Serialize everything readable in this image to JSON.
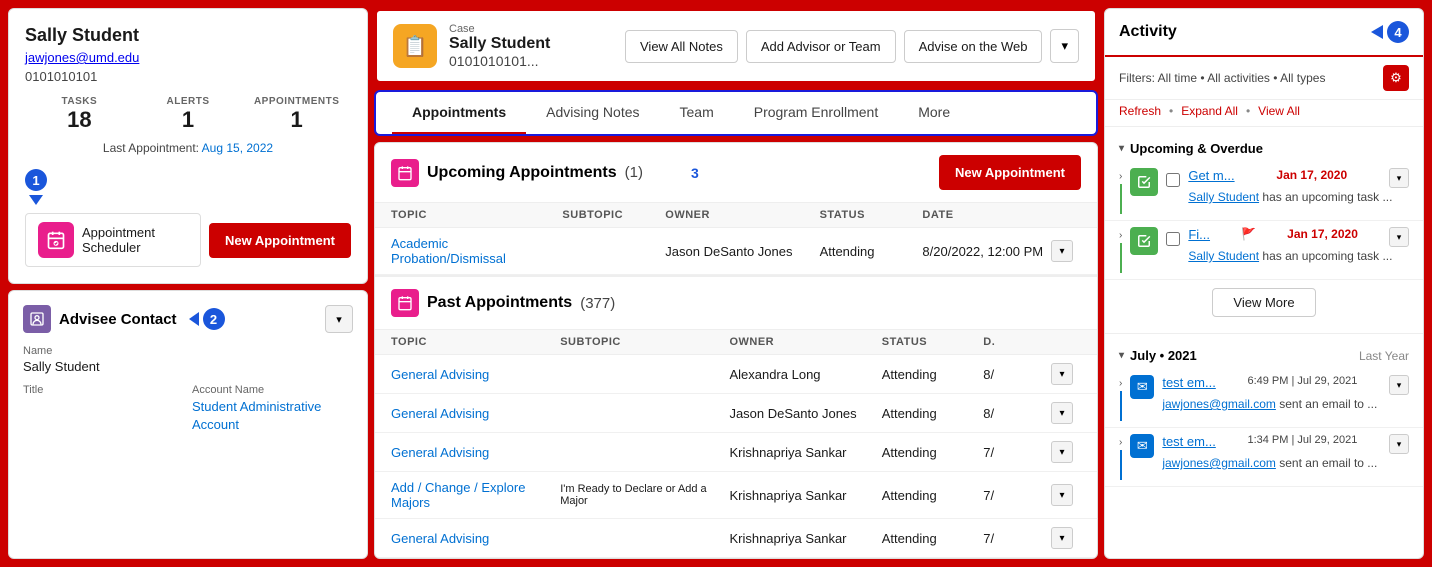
{
  "leftPanel": {
    "studentName": "Sally Student",
    "studentEmail": "jawjones@umd.edu",
    "studentId": "0101010101",
    "stats": {
      "tasksLabel": "TASKS",
      "tasksValue": "18",
      "alertsLabel": "ALERTS",
      "alertsValue": "1",
      "appointmentsLabel": "APPOINTMENTS",
      "appointmentsValue": "1"
    },
    "lastAppointment": "Last Appointment:",
    "lastAppointmentDate": "Aug 15, 2022",
    "appointmentSchedulerLabel": "Appointment\nScheduler",
    "newAppointmentBtn": "New Appointment",
    "annotation1": "1"
  },
  "adviseeContact": {
    "title": "Advisee Contact",
    "nameLabel": "Name",
    "nameValue": "Sally Student",
    "titleLabel": "Title",
    "accountNameLabel": "Account Name",
    "accountNameLink": "Student Administrative Account",
    "annotation2": "2"
  },
  "caseHeader": {
    "caseLabel": "Case",
    "caseName": "Sally Student",
    "caseId": "0101010101...",
    "viewAllNotesBtn": "View All Notes",
    "addAdvisorBtn": "Add Advisor or Team",
    "adviseOnWebBtn": "Advise on the Web"
  },
  "tabs": {
    "items": [
      {
        "label": "Appointments",
        "active": true
      },
      {
        "label": "Advising Notes",
        "active": false
      },
      {
        "label": "Team",
        "active": false
      },
      {
        "label": "Program Enrollment",
        "active": false
      },
      {
        "label": "More",
        "active": false
      }
    ]
  },
  "upcomingAppointments": {
    "title": "Upcoming Appointments",
    "count": "(1)",
    "newAppointmentBtn": "New Appointment",
    "annotation3": "3",
    "columns": [
      "TOPIC",
      "SUBTOPIC",
      "OWNER",
      "STATUS",
      "DATE"
    ],
    "rows": [
      {
        "topic": "Academic Probation/Dismissal",
        "subtopic": "",
        "owner": "Jason DeSanto Jones",
        "status": "Attending",
        "date": "8/20/2022, 12:00 PM"
      }
    ]
  },
  "pastAppointments": {
    "title": "Past Appointments",
    "count": "(377)",
    "columns": [
      "TOPIC",
      "SUBTOPIC",
      "OWNER",
      "STATUS",
      "D."
    ],
    "rows": [
      {
        "topic": "General Advising",
        "subtopic": "",
        "owner": "Alexandra Long",
        "status": "Attending",
        "date": "8/"
      },
      {
        "topic": "General Advising",
        "subtopic": "",
        "owner": "Jason DeSanto Jones",
        "status": "Attending",
        "date": "8/"
      },
      {
        "topic": "General Advising",
        "subtopic": "",
        "owner": "Krishnapriya Sankar",
        "status": "Attending",
        "date": "7/"
      },
      {
        "topic": "Add / Change / Explore Majors",
        "subtopic": "I'm Ready to Declare or Add a Major",
        "owner": "Krishnapriya Sankar",
        "status": "Attending",
        "date": "7/"
      },
      {
        "topic": "General Advising",
        "subtopic": "",
        "owner": "Krishnapriya Sankar",
        "status": "Attending",
        "date": "7/"
      }
    ]
  },
  "activity": {
    "title": "Activity",
    "annotation4": "4",
    "filtersText": "Filters: All time • All activities • All types",
    "refreshLink": "Refresh",
    "expandAllLink": "Expand All",
    "viewAllLink": "View All",
    "upcomingOverdue": {
      "sectionTitle": "Upcoming & Overdue",
      "items": [
        {
          "titleShort": "Get m...",
          "date": "Jan 17, 2020",
          "studentName": "Sally Student",
          "desc": "has an upcoming task ..."
        },
        {
          "titleShort": "Fi...",
          "date": "Jan 17, 2020",
          "studentName": "Sally Student",
          "desc": "has an upcoming task ...",
          "flagged": true
        }
      ],
      "viewMoreBtn": "View More"
    },
    "julySection": {
      "sectionTitle": "July • 2021",
      "sectionMeta": "Last Year",
      "items": [
        {
          "titleShort": "test em...",
          "time": "6:49 PM | Jul 29, 2021",
          "email": "jawjones@gmail.com",
          "desc": "sent an email to ..."
        },
        {
          "titleShort": "test em...",
          "time": "1:34 PM | Jul 29, 2021",
          "email": "jawjones@gmail.com",
          "desc": "sent an email to ..."
        }
      ]
    }
  }
}
